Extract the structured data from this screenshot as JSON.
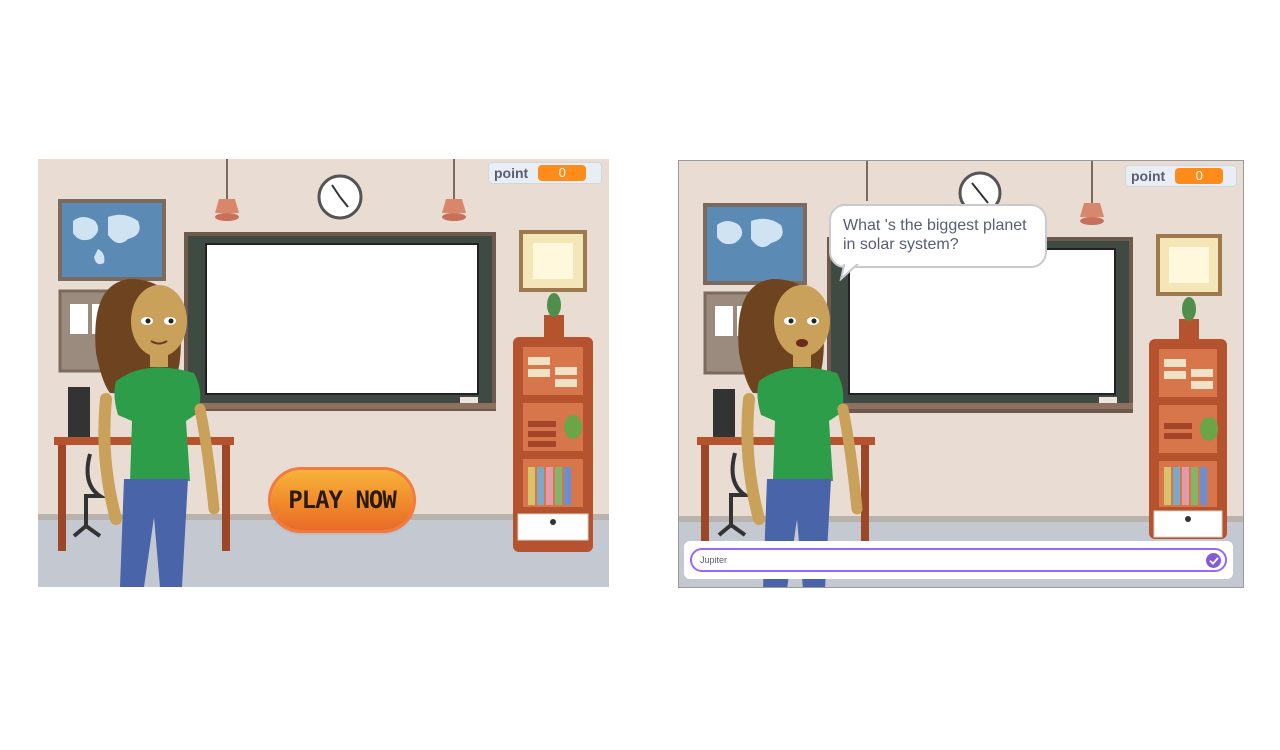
{
  "left_stage": {
    "score_monitor": {
      "label": "point",
      "value": "0"
    },
    "play_button": {
      "label": "PLAY NOW"
    }
  },
  "right_stage": {
    "score_monitor": {
      "label": "point",
      "value": "0"
    },
    "speech_bubble": {
      "line1": "What 's the biggest planet",
      "line2": "in solar system?"
    },
    "answer_input": {
      "value": "Jupiter"
    }
  },
  "colors": {
    "accent": "#ff8c1a",
    "ask_border": "#9966ff",
    "submit": "#855cd6"
  },
  "icons": {
    "submit": "check-icon"
  }
}
